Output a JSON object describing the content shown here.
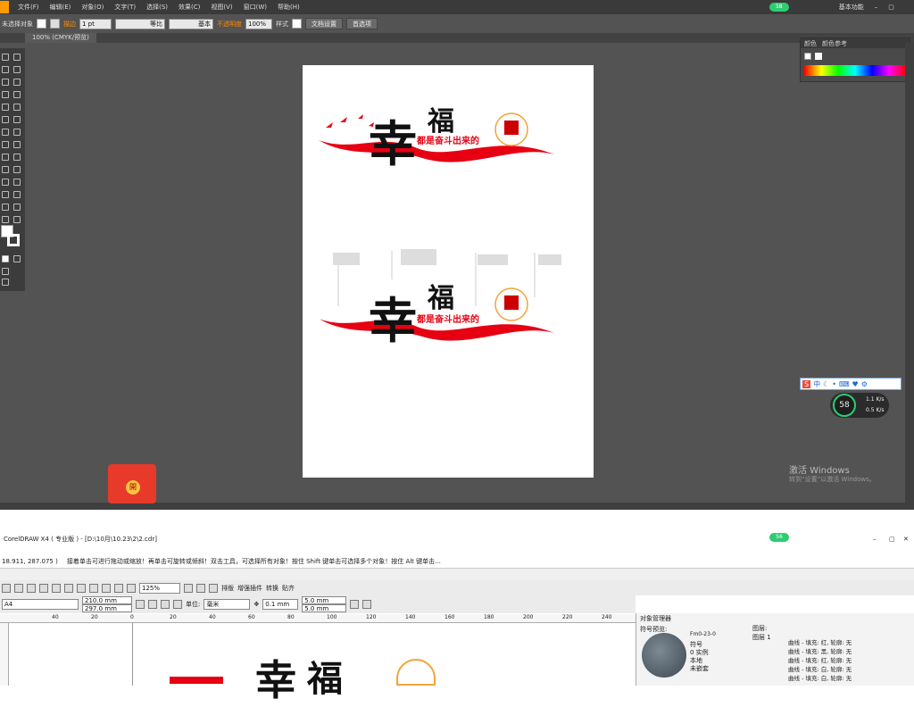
{
  "illustrator": {
    "menus": [
      "文件(F)",
      "编辑(E)",
      "对象(O)",
      "文字(T)",
      "选择(S)",
      "效果(C)",
      "视图(V)",
      "窗口(W)",
      "帮助(H)"
    ],
    "workspace": "基本功能",
    "badge": "58",
    "control": {
      "selection": "未选择对象",
      "stroke_label": "描边",
      "stroke_width": "1 pt",
      "profile": "等比",
      "brush": "基本",
      "opacity_label": "不透明度",
      "opacity_value": "100%",
      "style_label": "样式",
      "doc_setup": "文档设置",
      "prefs": "首选项"
    },
    "tab": "100% (CMYK/预览)",
    "panel": {
      "tab1": "颜色",
      "tab2": "颜色参考"
    },
    "artwork": {
      "char_big": "幸",
      "char_small": "福",
      "slogan": "都是奋斗出来的"
    },
    "ime": {
      "label": "中"
    },
    "speed": {
      "percent": "58",
      "up": "1.1",
      "down": "0.5",
      "unit": "K/s"
    },
    "activate_title": "激活 Windows",
    "activate_sub": "转到“设置”以激活 Windows。",
    "redpacket_label": "開"
  },
  "coreldraw": {
    "title": "CorelDRAW X4 ( 专业版 ) - [D:\\10月\\10.23\\2\\2.cdr]",
    "coords": "18.911, 287.075 )",
    "hint": "接着单击可进行拖动或缩放！再单击可旋转或倾斜！双击工具，可选择所有对象！按住 Shift 键单击可选择多个对象！按住 Alt 键单击...",
    "badge": "56",
    "zoom": "125%",
    "toolbar_labels": [
      "排版",
      "增强插件",
      "转换",
      "贴齐"
    ],
    "page_size": "A4",
    "width": "210.0 mm",
    "height": "297.0 mm",
    "units_label": "单位:",
    "units": "毫米",
    "nudge": "0.1 mm",
    "dup_x": "5.0 mm",
    "dup_y": "5.0 mm",
    "ruler_ticks": [
      "40",
      "20",
      "0",
      "20",
      "40",
      "60",
      "80",
      "100",
      "120",
      "140",
      "160",
      "180",
      "200",
      "220",
      "240"
    ],
    "docker_title": "对象管理器",
    "symbol_label": "符号预览:",
    "symbol_name": "Fm0-23-0",
    "symbol_info": [
      "符号",
      "0 实例",
      "本地",
      "未嵌套"
    ],
    "layers": [
      "图层:",
      "图层 1"
    ],
    "objects": [
      "曲线 - 填充: 红, 轮廓: 无",
      "曲线 - 填充: 黑, 轮廓: 无",
      "曲线 - 填充: 红, 轮廓: 无",
      "曲线 - 填充: 白, 轮廓: 无",
      "曲线 - 填充: 白, 轮廓: 无",
      "曲线 - 填充: 白, 轮廓: 无"
    ]
  }
}
